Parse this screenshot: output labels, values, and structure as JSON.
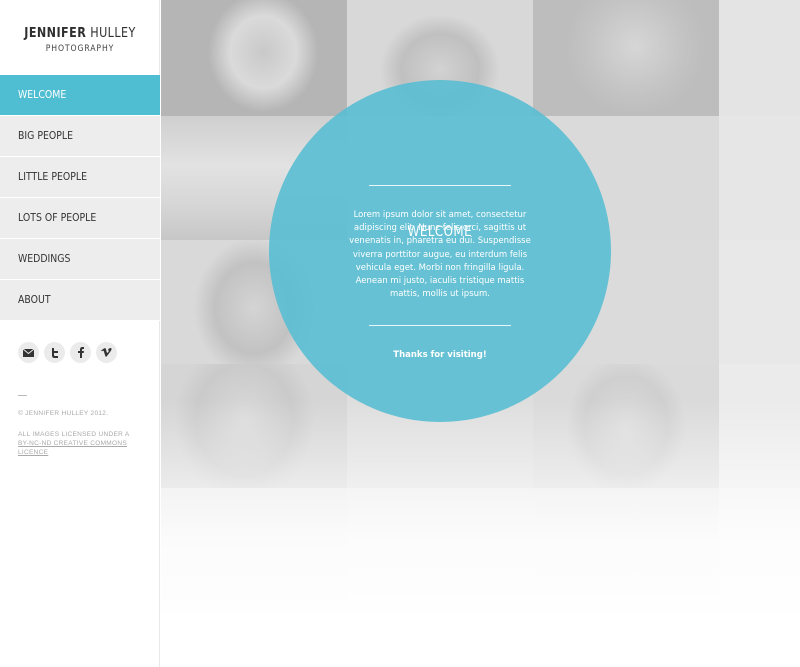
{
  "brand": {
    "name_first": "JENNIFER",
    "name_last": "HULLEY",
    "subtitle": "PHOTOGRAPHY"
  },
  "nav": {
    "items": [
      {
        "label": "WELCOME",
        "active": true
      },
      {
        "label": "BIG PEOPLE",
        "active": false
      },
      {
        "label": "LITTLE PEOPLE",
        "active": false
      },
      {
        "label": "LOTS OF PEOPLE",
        "active": false
      },
      {
        "label": "WEDDINGS",
        "active": false
      },
      {
        "label": "ABOUT",
        "active": false
      }
    ],
    "active_color": "#4fbdd2"
  },
  "social": {
    "icons": [
      "email-icon",
      "twitter-icon",
      "facebook-icon",
      "vimeo-icon"
    ]
  },
  "footer": {
    "copyright": "© JENNIFER HULLEY 2012.",
    "license_line1": "ALL IMAGES LICENSED UNDER A",
    "license_link": "BY-NC-ND CREATIVE COMMONS LICENCE"
  },
  "welcome": {
    "title": "WELCOME",
    "body": "Lorem ipsum dolor sit amet, consectetur adipiscing elit. Nunc felis orci, sagittis ut venenatis in, pharetra eu dui. Suspendisse viverra porttitor augue, eu interdum felis vehicula eget. Morbi non fringilla ligula. Aenean mi justo, iaculis tristique mattis mattis, mollis ut ipsum.",
    "thanks": "Thanks for visiting!",
    "circle_color": "#58bed2"
  }
}
